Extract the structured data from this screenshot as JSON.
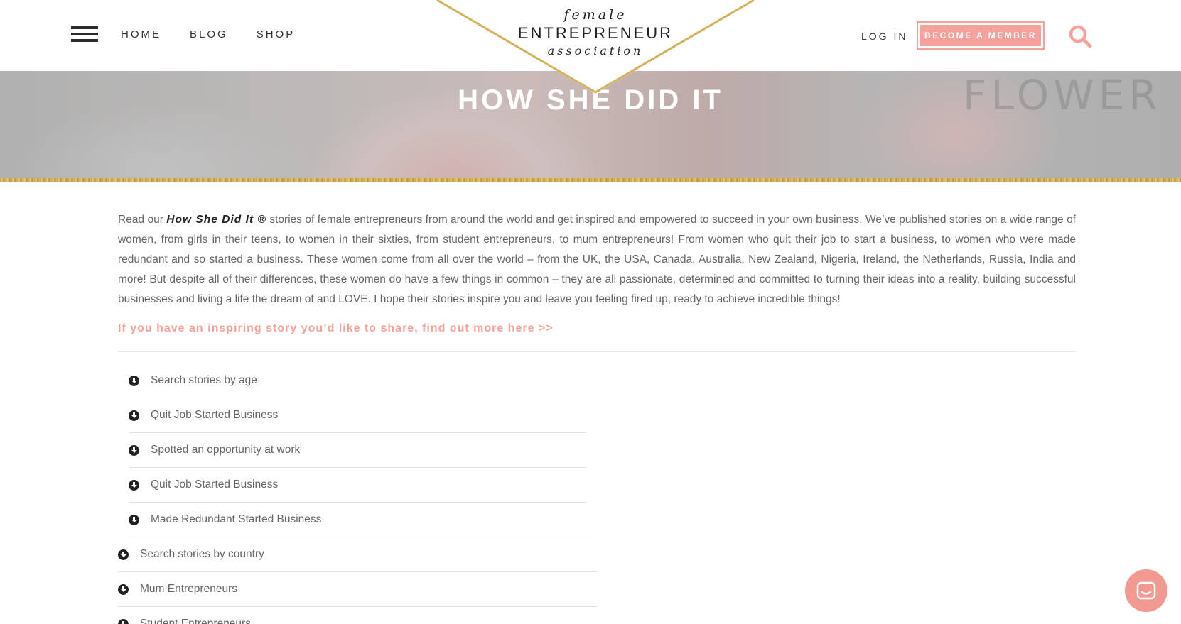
{
  "header": {
    "nav": [
      "HOME",
      "BLOG",
      "SHOP"
    ],
    "logo": {
      "top": "female",
      "middle": "ENTREPRENEUR",
      "bottom": "association"
    },
    "login_label": "LOG IN",
    "member_label": "BECOME A MEMBER"
  },
  "hero": {
    "title": "HOW SHE DID IT",
    "background_word": "FLOWER"
  },
  "intro": {
    "lead": "Read our ",
    "brand": "How She Did It ®",
    "body": " stories of female entrepreneurs from around the world and get inspired and empowered to succeed in your own business. We’ve published stories on a wide range of women, from girls in their teens, to women in their sixties, from student entrepreneurs, to mum entrepreneurs! From women who quit their job to start a business, to women who were made redundant and so started a business. These women come from all over the world – from the UK, the USA, Canada, Australia, New Zealand, Nigeria, Ireland, the Netherlands, Russia, India and more! But despite all of their differences, these women do have a few things in common – they are all passionate, determined and committed to turning their ideas into a reality, building successful businesses and living a life the dream of and LOVE. I hope their stories inspire you and leave you feeling fired up, ready to achieve incredible things!"
  },
  "share_link": "If you have an inspiring story you’d like to share, find out more here >>",
  "accordion": {
    "sub_items": [
      "Search stories by age",
      "Quit Job Started Business",
      "Spotted an opportunity at work",
      "Quit Job Started Business",
      "Made Redundant Started Business"
    ],
    "items": [
      "Search stories by country",
      "Mum Entrepreneurs",
      "Student Entrepreneurs"
    ]
  },
  "colors": {
    "accent": "#f6a29a",
    "gold": "#c8a24a",
    "text": "#666666"
  }
}
